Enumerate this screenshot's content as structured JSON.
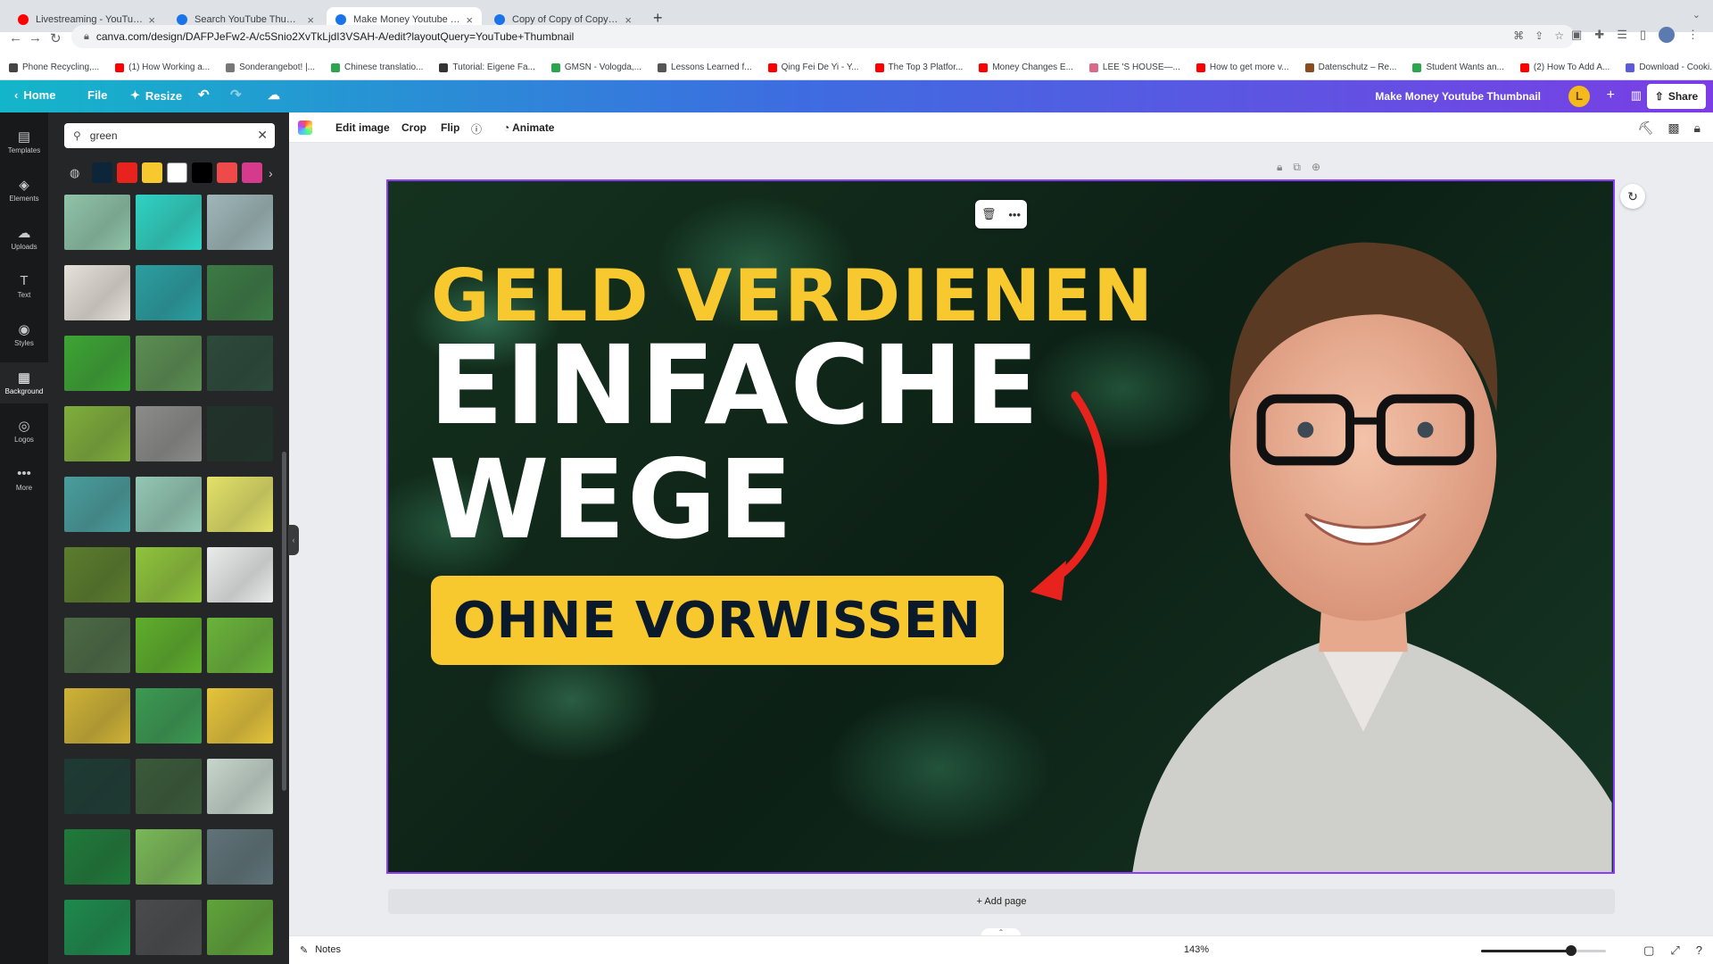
{
  "browser": {
    "tabs": [
      {
        "title": "Livestreaming - YouTube S",
        "favicon_color": "#ff0000",
        "active": false
      },
      {
        "title": "Search YouTube Thumbnail - C",
        "favicon_color": "#1a73e8",
        "active": false
      },
      {
        "title": "Make Money Youtube Thumbn",
        "favicon_color": "#1a73e8",
        "active": true
      },
      {
        "title": "Copy of Copy of Copy of Copy",
        "favicon_color": "#1a73e8",
        "active": false
      }
    ],
    "url": "canva.com/design/DAFPJeFw2-A/c5Snio2XvTkLjdI3VSAH-A/edit?layoutQuery=YouTube+Thumbnail",
    "bookmarks": [
      {
        "label": "Phone Recycling,...",
        "color": "#444444"
      },
      {
        "label": "(1) How Working a...",
        "color": "#ff0000"
      },
      {
        "label": "Sonderangebot! |...",
        "color": "#777777"
      },
      {
        "label": "Chinese translatio...",
        "color": "#2da44e"
      },
      {
        "label": "Tutorial: Eigene Fa...",
        "color": "#333333"
      },
      {
        "label": "GMSN - Vologda,...",
        "color": "#2da44e"
      },
      {
        "label": "Lessons Learned f...",
        "color": "#555555"
      },
      {
        "label": "Qing Fei De Yi - Y...",
        "color": "#ff0000"
      },
      {
        "label": "The Top 3 Platfor...",
        "color": "#ff0000"
      },
      {
        "label": "Money Changes E...",
        "color": "#ff0000"
      },
      {
        "label": "LEE 'S HOUSE—...",
        "color": "#d96b8a"
      },
      {
        "label": "How to get more v...",
        "color": "#ff0000"
      },
      {
        "label": "Datenschutz – Re...",
        "color": "#8a4b1f"
      },
      {
        "label": "Student Wants an...",
        "color": "#2da44e"
      },
      {
        "label": "(2) How To Add A...",
        "color": "#ff0000"
      },
      {
        "label": "Download - Cooki...",
        "color": "#5b5bd6"
      }
    ]
  },
  "canva": {
    "home_label": "Home",
    "file_label": "File",
    "resize_label": "Resize",
    "design_title": "Make Money Youtube Thumbnail",
    "avatar_letter": "L",
    "share_label": "Share",
    "rail": [
      {
        "label": "Templates",
        "icon": "▤"
      },
      {
        "label": "Elements",
        "icon": "◈"
      },
      {
        "label": "Uploads",
        "icon": "☁"
      },
      {
        "label": "Text",
        "icon": "T"
      },
      {
        "label": "Styles",
        "icon": "◉"
      },
      {
        "label": "Background",
        "icon": "▦",
        "active": true
      },
      {
        "label": "Logos",
        "icon": "◎"
      },
      {
        "label": "More",
        "icon": "•••"
      }
    ],
    "search_value": "green",
    "swatches": [
      "#0d2538",
      "#e8231d",
      "#f8c82f",
      "#ffffff",
      "#000000",
      "#ef4a4a",
      "#d63a8c"
    ],
    "thumbnails": [
      [
        "#8fc4a8",
        "#2fd3c3",
        "#9fb7b9"
      ],
      [
        "#e6e1d9",
        "#2a9fa2",
        "#3c7a45"
      ],
      [
        "#3da534",
        "#5b8f52",
        "#2c4a3b"
      ],
      [
        "#7fae3b",
        "#8c8c8a",
        "#203329"
      ],
      [
        "#4a9d9d",
        "#93c7b4",
        "#e3e268"
      ],
      [
        "#5b7d2c",
        "#8fc43b",
        "#e9ecea"
      ],
      [
        "#4c6a44",
        "#5eae2b",
        "#6ab43a"
      ],
      [
        "#cfb236",
        "#3b9a52",
        "#e5c43a"
      ],
      [
        "#1d3b34",
        "#3a5a3a",
        "#c7d6cd"
      ],
      [
        "#1f7a3a",
        "#79b857",
        "#5f7378"
      ],
      [
        "#1d8a4c",
        "#4a4b4d",
        "#5fa43a"
      ]
    ],
    "edit_bar": {
      "edit_image": "Edit image",
      "crop": "Crop",
      "flip": "Flip",
      "animate": "Animate"
    },
    "design": {
      "line1": "GELD VERDIENEN",
      "line2": "EINFACHE",
      "line3": "WEGE",
      "banner": "OHNE VORWISSEN",
      "accent_yellow": "#f8c82f",
      "arrow_color": "#e8231d"
    },
    "add_page_label": "+ Add page",
    "notes_label": "Notes",
    "zoom_label": "143%",
    "zoom_fraction": 0.72
  }
}
